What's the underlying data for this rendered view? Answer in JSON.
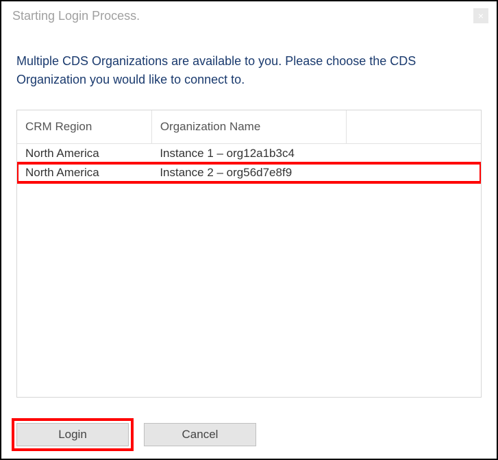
{
  "window": {
    "title": "Starting Login Process.",
    "close_label": "×"
  },
  "instruction": "Multiple CDS Organizations are available to you. Please choose the CDS Organization you would like to connect to.",
  "table": {
    "headers": {
      "region": "CRM Region",
      "org": "Organization Name",
      "empty": ""
    },
    "rows": [
      {
        "region": "North America",
        "org": "Instance 1 – org12a1b3c4",
        "highlighted": false
      },
      {
        "region": "North America",
        "org": "Instance 2 – org56d7e8f9",
        "highlighted": true
      }
    ]
  },
  "buttons": {
    "login": "Login",
    "cancel": "Cancel"
  }
}
